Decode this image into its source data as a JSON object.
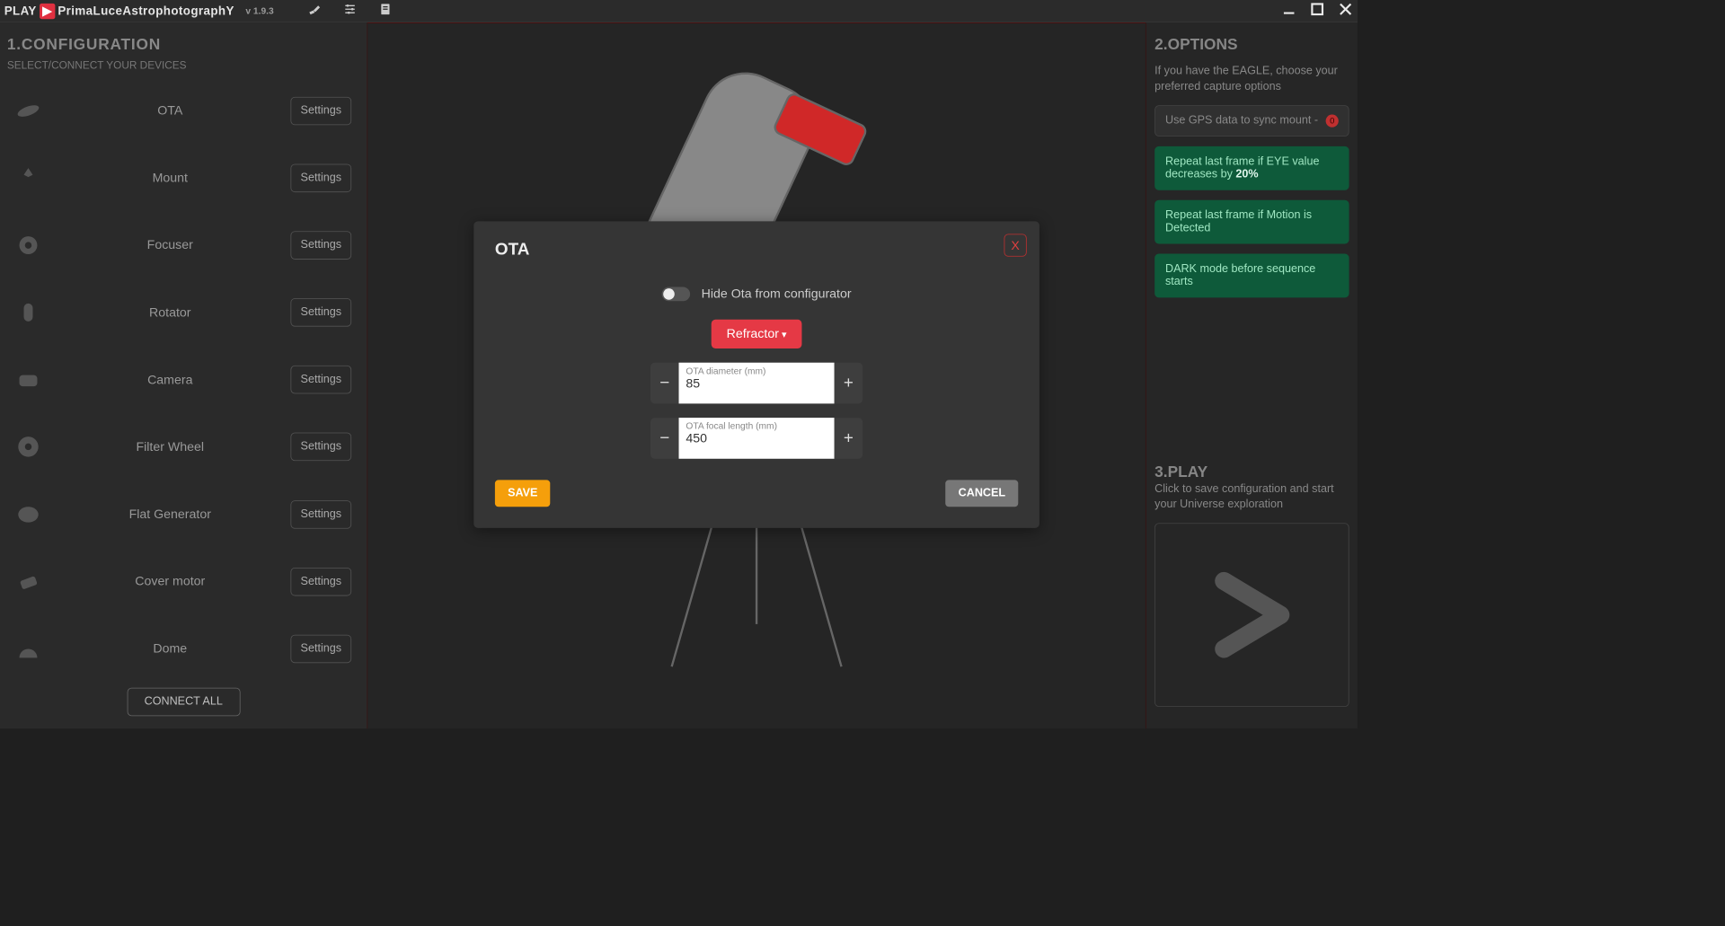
{
  "titlebar": {
    "app_prefix": "PLAY",
    "app_name": "PrimaLuceAstrophotographY",
    "version": "v 1.9.3"
  },
  "sidebar": {
    "title": "1.CONFIGURATION",
    "subtitle": "SELECT/CONNECT YOUR DEVICES",
    "settings_label": "Settings",
    "connect_all": "CONNECT ALL",
    "devices": [
      {
        "name": "OTA"
      },
      {
        "name": "Mount"
      },
      {
        "name": "Focuser"
      },
      {
        "name": "Rotator"
      },
      {
        "name": "Camera"
      },
      {
        "name": "Filter Wheel"
      },
      {
        "name": "Flat Generator"
      },
      {
        "name": "Cover motor"
      },
      {
        "name": "Dome"
      }
    ]
  },
  "dialog": {
    "title": "OTA",
    "close": "X",
    "hide_label": "Hide Ota from configurator",
    "type_label": "Refractor",
    "diameter_label": "OTA diameter (mm)",
    "diameter_value": "85",
    "focal_label": "OTA focal length (mm)",
    "focal_value": "450",
    "save": "SAVE",
    "cancel": "CANCEL"
  },
  "options": {
    "title": "2.OPTIONS",
    "subtitle": "If you have the EAGLE, choose your preferred capture options",
    "gps": "Use GPS data to sync mount  -",
    "gps_badge": "0",
    "eye_prefix": "Repeat last frame if EYE value decreases by ",
    "eye_value": "20%",
    "motion": "Repeat last frame if Motion is Detected",
    "dark": "DARK mode before sequence starts"
  },
  "play": {
    "title": "3.PLAY",
    "subtitle": "Click to save configuration and start your Universe exploration"
  }
}
